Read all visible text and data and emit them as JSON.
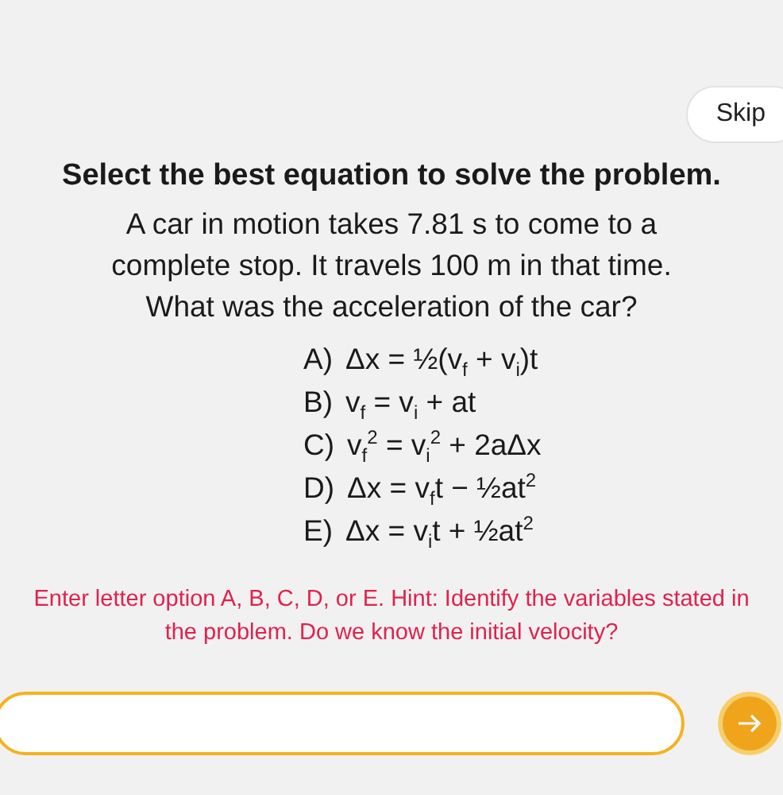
{
  "skip_button": {
    "label": "Skip"
  },
  "instruction": "Select the best equation to solve the problem.",
  "problem": [
    "A car in motion takes 7.81 s to come to a",
    "complete stop. It travels 100 m in that time.",
    "What was the acceleration of the car?"
  ],
  "options": [
    {
      "letter": "A)",
      "equation": "Δx = ½(v$_{f}$ + v$_{i}$)t"
    },
    {
      "letter": "B)",
      "equation": "v$_{f}$ = v$_{i}$ + at"
    },
    {
      "letter": "C)",
      "equation": "v$_{f}$$^{2}$ = v$_{i}$$^{2}$ + 2aΔx"
    },
    {
      "letter": "D)",
      "equation": "Δx = v$_{f}$t − ½at$^{2}$"
    },
    {
      "letter": "E)",
      "equation": "Δx = v$_{i}$t + ½at$^{2}$"
    }
  ],
  "hint": "Enter letter option A, B, C, D, or E. Hint: Identify the variables stated in the problem. Do we know the initial velocity?"
}
